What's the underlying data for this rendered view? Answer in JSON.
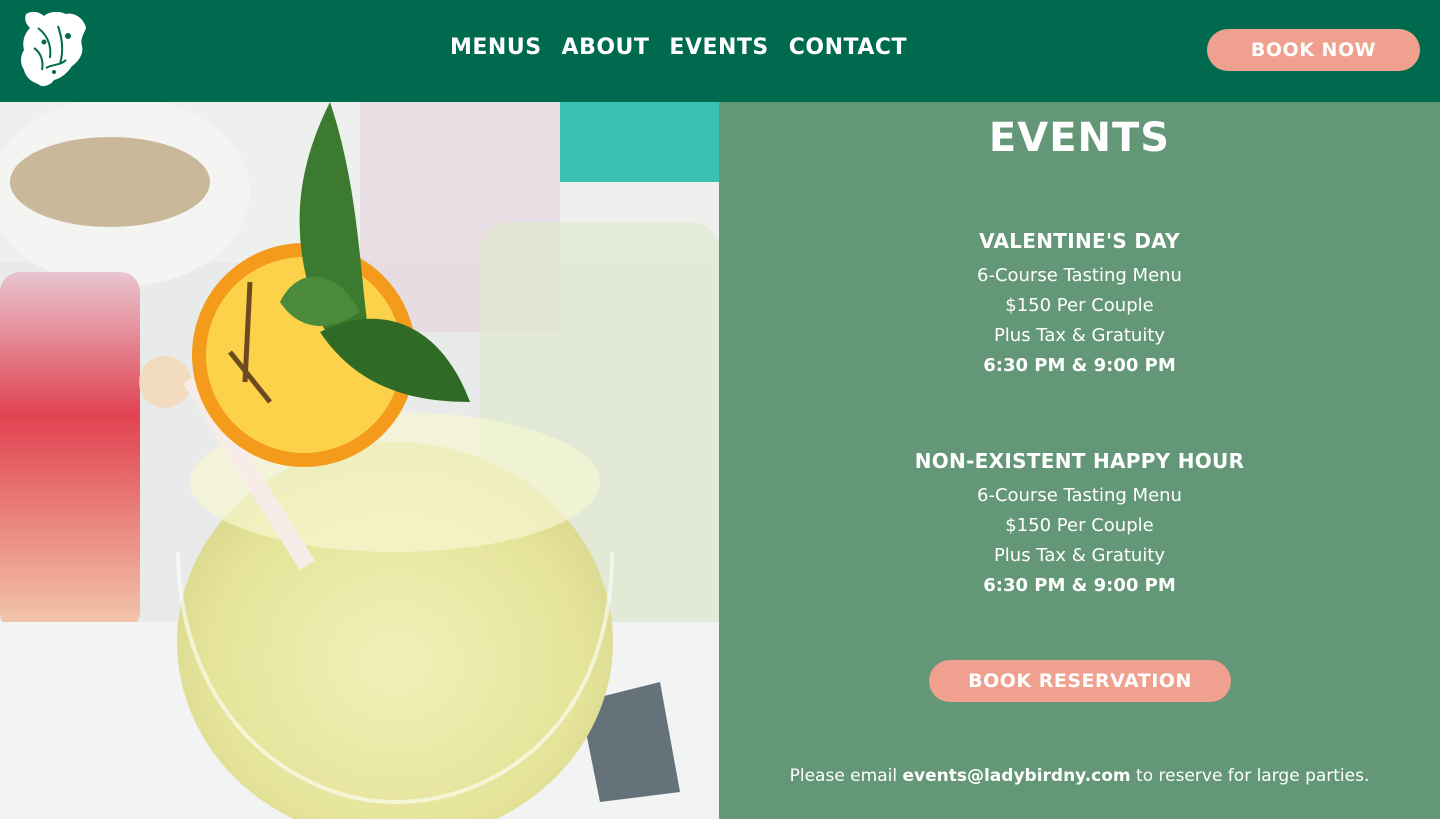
{
  "nav": {
    "items": [
      "MENUS",
      "ABOUT",
      "EVENTS",
      "CONTACT"
    ],
    "cta": "BOOK NOW"
  },
  "logo": {
    "icon": "ladybird-logo-icon"
  },
  "hero_image": {
    "description_icon": "cocktail-photo"
  },
  "events": {
    "title": "EVENTS",
    "items": [
      {
        "name": "VALENTINE'S DAY",
        "line1": "6-Course Tasting Menu",
        "line2": "$150 Per Couple",
        "line3": "Plus Tax & Gratuity",
        "time": "6:30 PM & 9:00 PM"
      },
      {
        "name": "NON-EXISTENT HAPPY HOUR",
        "line1": "6-Course Tasting Menu",
        "line2": "$150 Per Couple",
        "line3": "Plus Tax & Gratuity",
        "time": "6:30 PM & 9:00 PM"
      }
    ],
    "cta": "BOOK RESERVATION",
    "note_prefix": "Please email",
    "note_email": "events@ladybirdny.com",
    "note_suffix": "to reserve for large parties."
  },
  "colors": {
    "header_bg": "#006a4e",
    "panel_bg": "#649777",
    "button_bg": "#f0a08e"
  }
}
